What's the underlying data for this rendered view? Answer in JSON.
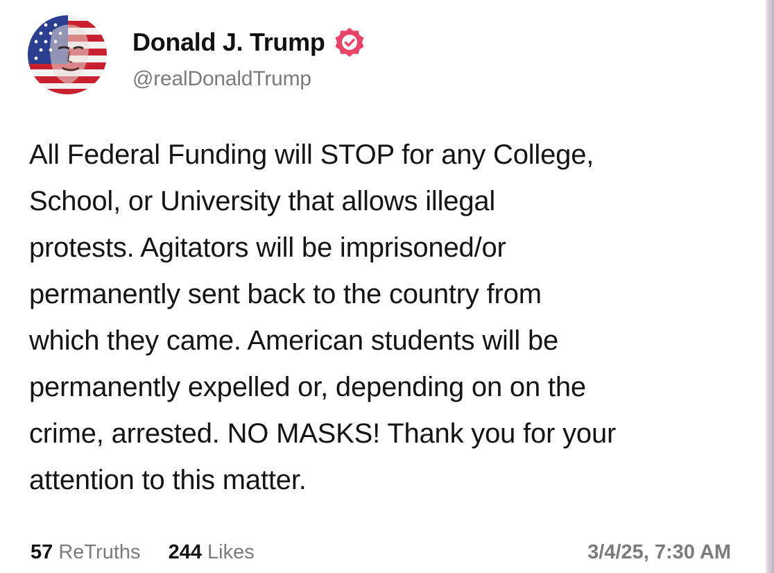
{
  "author": {
    "display_name": "Donald J. Trump",
    "handle": "@realDonaldTrump",
    "verified": true,
    "verified_badge_color": "#e8456b",
    "avatar_icon": "portrait-flag-avatar"
  },
  "post": {
    "lines": [
      "All Federal Funding will STOP for any College,",
      "School, or University that allows illegal",
      "protests. Agitators will be imprisoned/or",
      "permanently sent back to the country from",
      "which they came. American students will be",
      "permanently expelled or, depending on on the",
      "crime, arrested. NO MASKS! Thank you for your",
      "attention to this matter."
    ]
  },
  "stats": {
    "retruths_count": "57",
    "retruths_label": "ReTruths",
    "likes_count": "244",
    "likes_label": "Likes"
  },
  "timestamp": "3/4/25, 7:30 AM"
}
